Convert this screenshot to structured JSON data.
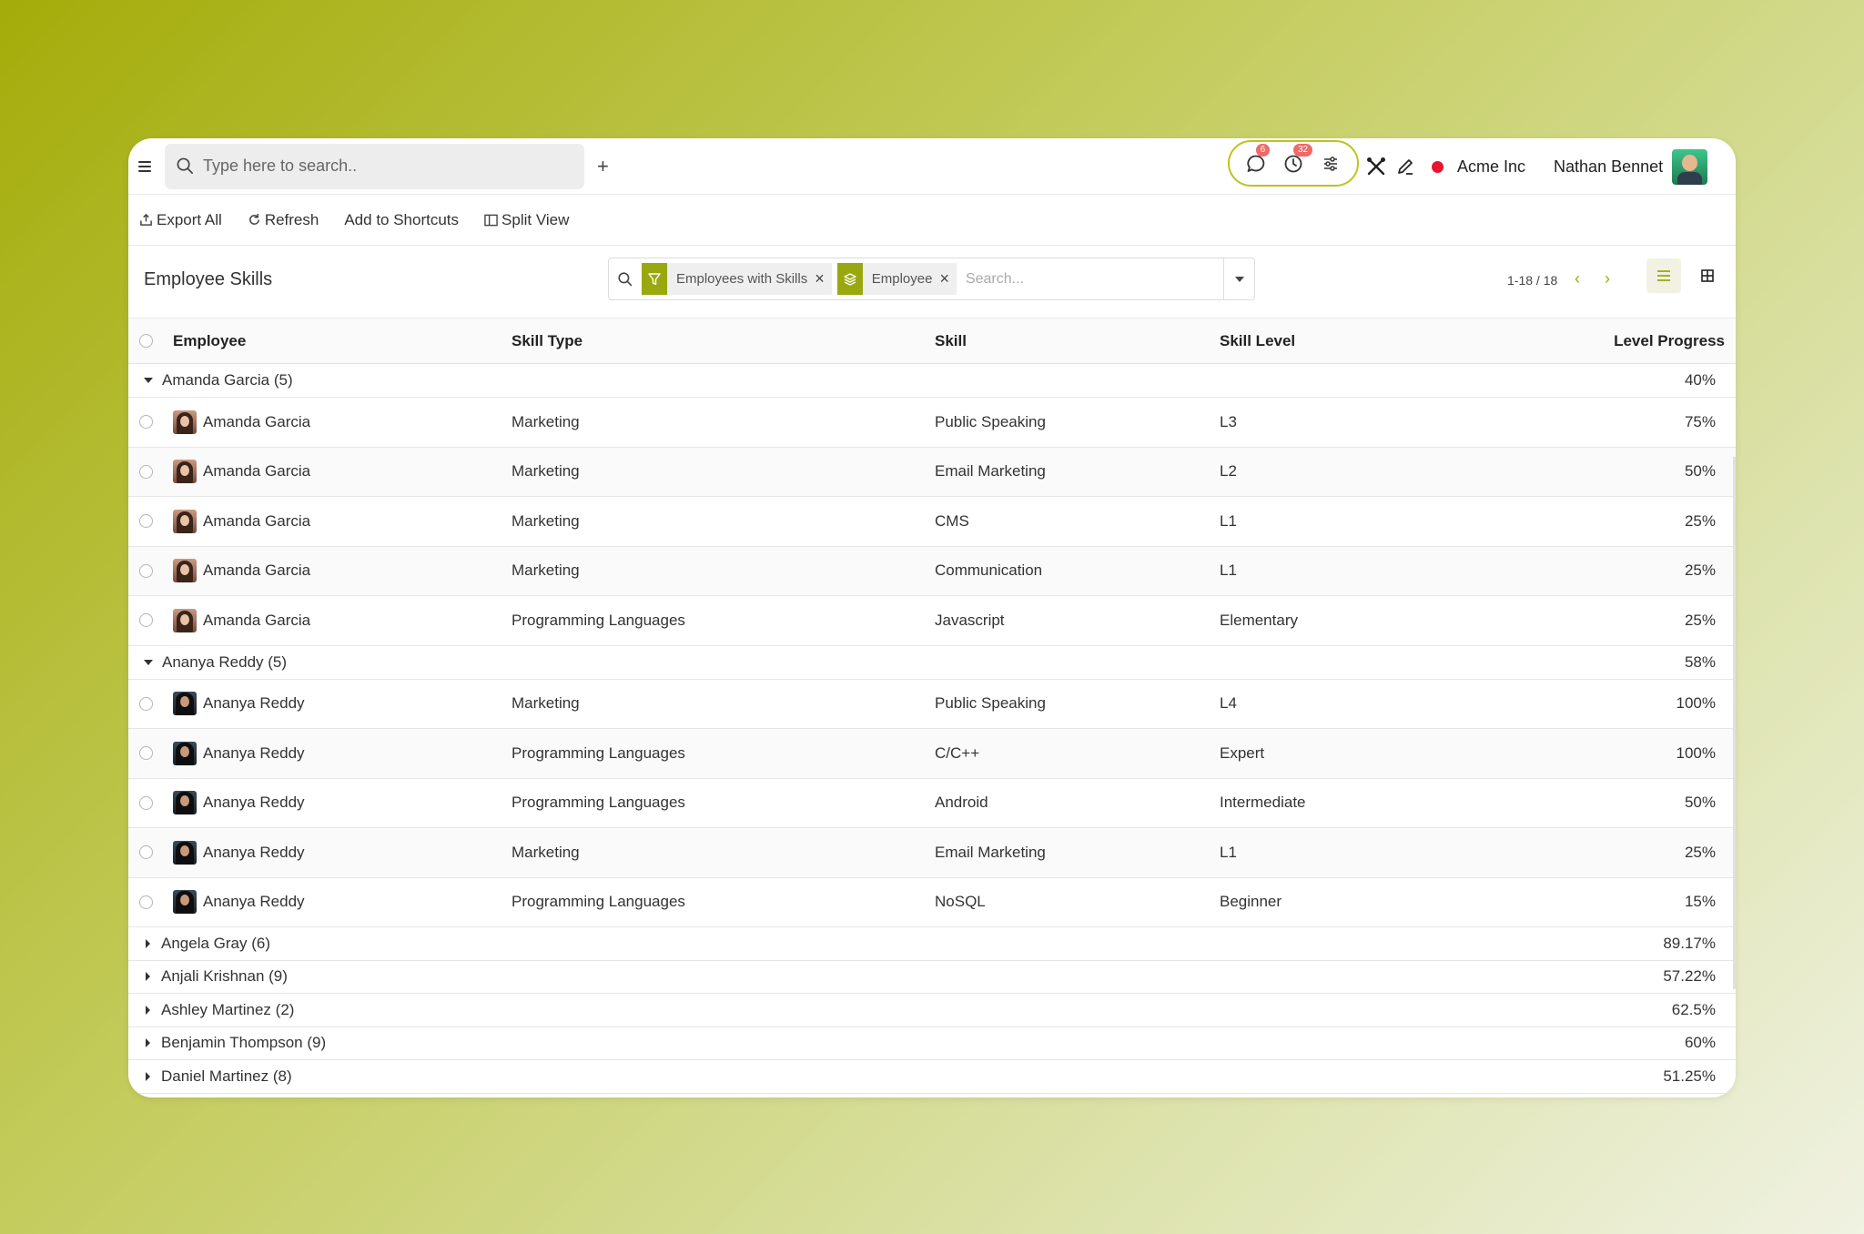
{
  "search": {
    "placeholder": "Type here to search.."
  },
  "notifications": {
    "messages_count": "6",
    "activity_count": "32"
  },
  "company": "Acme Inc",
  "user": {
    "name": "Nathan Bennet"
  },
  "actions": {
    "export_all": "Export All",
    "refresh": "Refresh",
    "add_to_shortcuts": "Add to Shortcuts",
    "split_view": "Split View"
  },
  "page_title": "Employee Skills",
  "filters": {
    "facets": [
      {
        "label": "Employees with Skills",
        "icon": "filter-icon"
      },
      {
        "label": "Employee",
        "icon": "layers-icon"
      }
    ],
    "placeholder": "Search..."
  },
  "pager": {
    "range": "1-18 / 18"
  },
  "columns": {
    "employee": "Employee",
    "skill_type": "Skill Type",
    "skill": "Skill",
    "skill_level": "Skill Level",
    "level_progress": "Level Progress"
  },
  "groups": [
    {
      "label": "Amanda Garcia (5)",
      "progress": "40%",
      "rows": [
        {
          "employee": "Amanda Garcia",
          "skill_type": "Marketing",
          "skill": "Public Speaking",
          "level": "L3",
          "progress": "75%"
        },
        {
          "employee": "Amanda Garcia",
          "skill_type": "Marketing",
          "skill": "Email Marketing",
          "level": "L2",
          "progress": "50%"
        },
        {
          "employee": "Amanda Garcia",
          "skill_type": "Marketing",
          "skill": "CMS",
          "level": "L1",
          "progress": "25%"
        },
        {
          "employee": "Amanda Garcia",
          "skill_type": "Marketing",
          "skill": "Communication",
          "level": "L1",
          "progress": "25%"
        },
        {
          "employee": "Amanda Garcia",
          "skill_type": "Programming Languages",
          "skill": "Javascript",
          "level": "Elementary",
          "progress": "25%"
        }
      ]
    },
    {
      "label": "Ananya Reddy (5)",
      "progress": "58%",
      "rows": [
        {
          "employee": "Ananya Reddy",
          "skill_type": "Marketing",
          "skill": "Public Speaking",
          "level": "L4",
          "progress": "100%"
        },
        {
          "employee": "Ananya Reddy",
          "skill_type": "Programming Languages",
          "skill": "C/C++",
          "level": "Expert",
          "progress": "100%"
        },
        {
          "employee": "Ananya Reddy",
          "skill_type": "Programming Languages",
          "skill": "Android",
          "level": "Intermediate",
          "progress": "50%"
        },
        {
          "employee": "Ananya Reddy",
          "skill_type": "Marketing",
          "skill": "Email Marketing",
          "level": "L1",
          "progress": "25%"
        },
        {
          "employee": "Ananya Reddy",
          "skill_type": "Programming Languages",
          "skill": "NoSQL",
          "level": "Beginner",
          "progress": "15%"
        }
      ]
    }
  ],
  "collapsed_groups": [
    {
      "label": "Angela Gray (6)",
      "progress": "89.17%"
    },
    {
      "label": "Anjali Krishnan (9)",
      "progress": "57.22%"
    },
    {
      "label": "Ashley Martinez (2)",
      "progress": "62.5%"
    },
    {
      "label": "Benjamin Thompson (9)",
      "progress": "60%"
    },
    {
      "label": "Daniel Martinez (8)",
      "progress": "51.25%"
    }
  ],
  "colors": {
    "accent": "#9aa80f",
    "status_dot": "#e8132f",
    "badge": "#f06868"
  }
}
